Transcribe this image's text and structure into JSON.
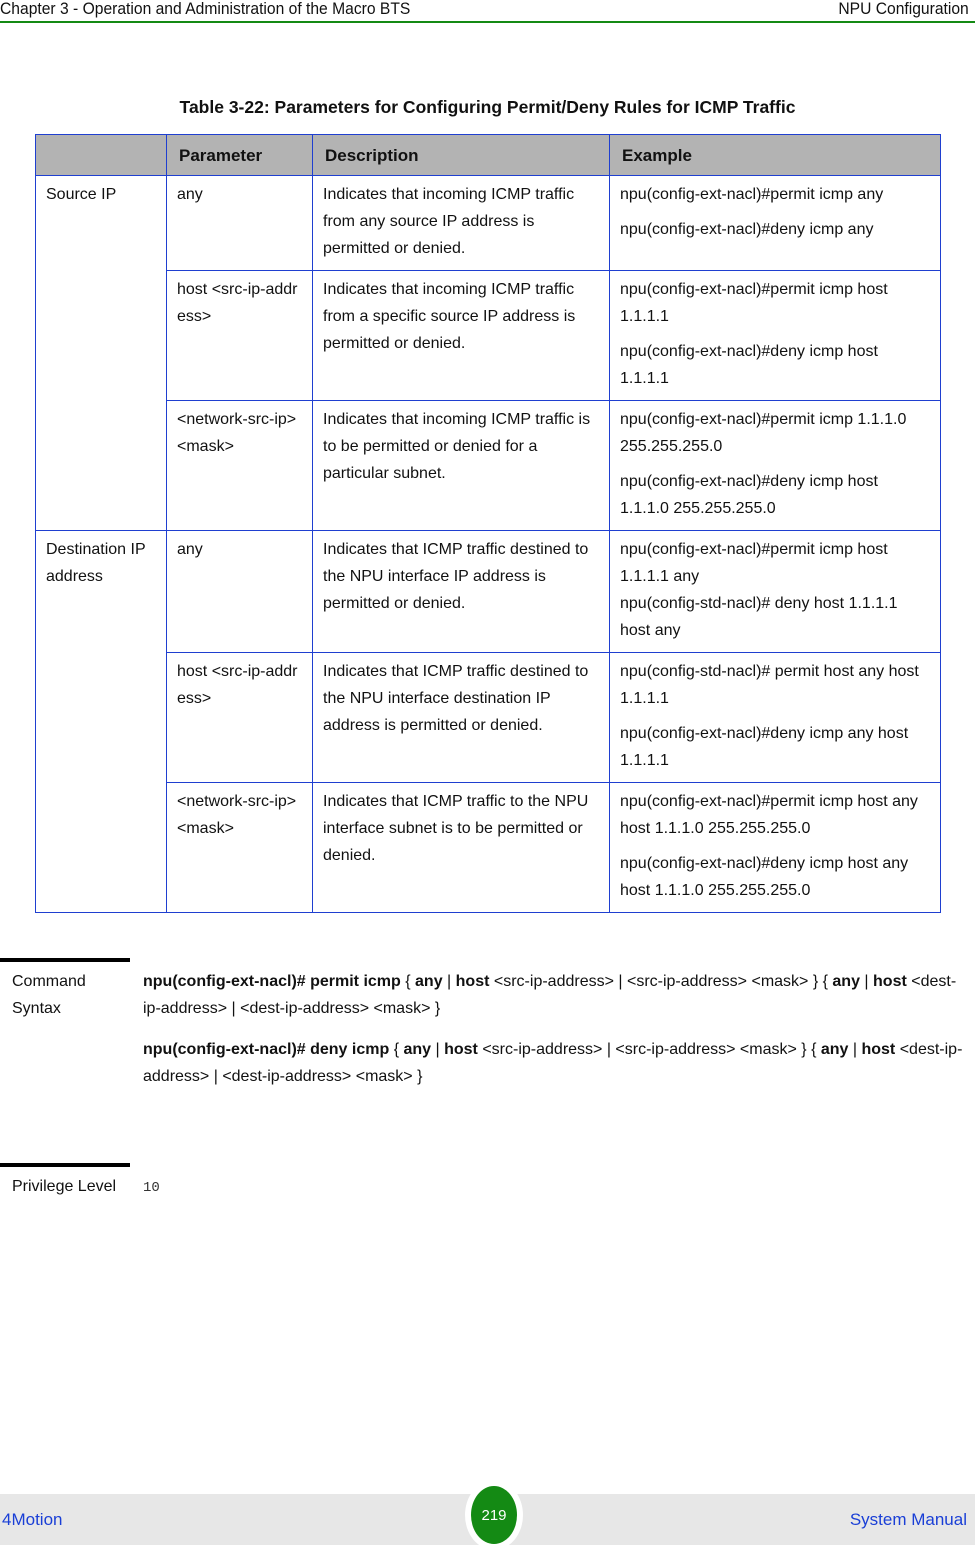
{
  "header": {
    "chapter": "Chapter 3 - Operation and Administration of the Macro BTS",
    "section": "NPU Configuration"
  },
  "table": {
    "title": "Table 3-22: Parameters for Configuring Permit/Deny Rules for ICMP Traffic",
    "columns": [
      "",
      "Parameter",
      "Description",
      "Example"
    ],
    "groups": [
      {
        "name": "Source IP",
        "rows": [
          {
            "parameter": "any",
            "description": "Indicates that incoming ICMP traffic from any source IP address is permitted or denied.",
            "examples": [
              "npu(config-ext-nacl)#permit icmp any",
              "npu(config-ext-nacl)#deny icmp any"
            ]
          },
          {
            "parameter": "host <src-ip-address>",
            "description": "Indicates that incoming ICMP traffic from a specific source IP address is permitted or denied.",
            "examples": [
              "npu(config-ext-nacl)#permit icmp host 1.1.1.1",
              "npu(config-ext-nacl)#deny icmp host 1.1.1.1"
            ]
          },
          {
            "parameter": "<network-src-ip> <mask>",
            "description": "Indicates that incoming ICMP traffic is to be permitted or denied for a particular subnet.",
            "examples": [
              "npu(config-ext-nacl)#permit icmp 1.1.1.0 255.255.255.0",
              "npu(config-ext-nacl)#deny icmp host 1.1.1.0 255.255.255.0"
            ]
          }
        ]
      },
      {
        "name": "Destination IP address",
        "rows": [
          {
            "parameter": "any",
            "description": "Indicates that ICMP traffic destined to the NPU interface IP address is permitted or denied.",
            "examples": [
              "npu(config-ext-nacl)#permit icmp host 1.1.1.1 any",
              "npu(config-std-nacl)# deny host 1.1.1.1 host any"
            ]
          },
          {
            "parameter": "host <src-ip-address>",
            "description": "Indicates that ICMP traffic destined to the NPU interface destination IP address is permitted or denied.",
            "examples": [
              "npu(config-std-nacl)# permit host any host 1.1.1.1",
              "npu(config-ext-nacl)#deny icmp any host 1.1.1.1"
            ]
          },
          {
            "parameter": "<network-src-ip> <mask>",
            "description": "Indicates that ICMP traffic to the NPU interface subnet is to be permitted or denied.",
            "examples": [
              "npu(config-ext-nacl)#permit icmp host any host 1.1.1.0 255.255.255.0",
              "npu(config-ext-nacl)#deny icmp host any host 1.1.1.0 255.255.255.0"
            ]
          }
        ]
      }
    ]
  },
  "command_syntax": {
    "label": "Command Syntax",
    "lines": [
      {
        "prompt": "npu(config-ext-nacl)# permit icmp",
        "t1": " { ",
        "any1": "any",
        "t2": " | ",
        "host1": "host",
        "t3": " <src-ip-address> | <src-ip-address> <mask> }  { ",
        "any2": "any",
        "t4": " | ",
        "host2": "host",
        "t5": " <dest-ip-address> | <dest-ip-address> <mask> }"
      },
      {
        "prompt": "npu(config-ext-nacl)# deny icmp",
        "t1": " { ",
        "any1": "any",
        "t2": " | ",
        "host1": "host",
        "t3": " <src-ip-address> | <src-ip-address> <mask> }  { ",
        "any2": "any",
        "t4": " | ",
        "host2": "host",
        "t5": " <dest-ip-address> | <dest-ip-address> <mask> }"
      }
    ]
  },
  "privilege_level": {
    "label": "Privilege Level",
    "value": "10"
  },
  "footer": {
    "product": "4Motion",
    "page_number": "219",
    "doc_type": "System Manual"
  },
  "colors": {
    "accent_green": "#148a14",
    "table_border_blue": "#1f3fd0",
    "header_gray": "#b3b3b3",
    "footer_link_blue": "#1a3fd6"
  }
}
